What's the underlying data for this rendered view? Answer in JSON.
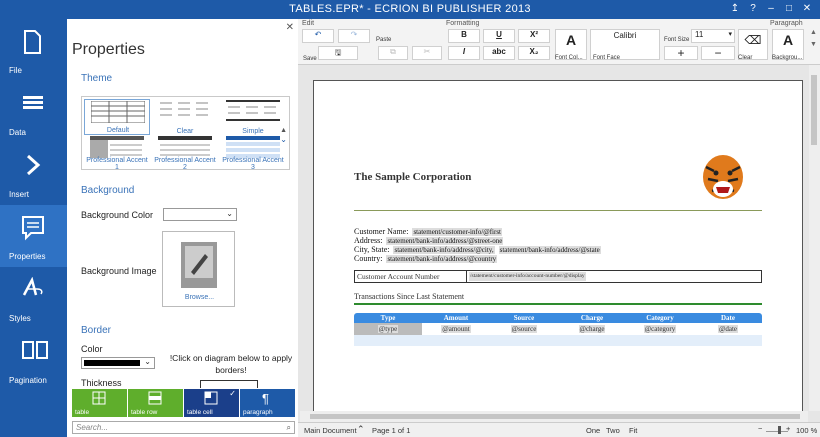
{
  "window": {
    "title": "TABLES.EPR* - ECRION BI PUBLISHER 2013"
  },
  "nav": [
    {
      "label": "File"
    },
    {
      "label": "Data"
    },
    {
      "label": "Insert"
    },
    {
      "label": "Properties"
    },
    {
      "label": "Styles"
    },
    {
      "label": "Pagination"
    }
  ],
  "properties": {
    "title": "Properties",
    "theme_label": "Theme",
    "themes": [
      "Default",
      "Clear",
      "Simple",
      "Professional Accent 1",
      "Professional Accent 2",
      "Professional Accent 3"
    ],
    "background_label": "Background",
    "bg_color_label": "Background Color",
    "bg_image_label": "Background Image",
    "browse_label": "Browse...",
    "border_label": "Border",
    "color_label": "Color",
    "hint": "!Click on diagram below to apply borders!",
    "thickness_label": "Thickness",
    "tiles": [
      "table",
      "table row",
      "table cell",
      "paragraph"
    ],
    "search_placeholder": "Search..."
  },
  "ribbon": {
    "groups": {
      "edit": "Edit",
      "formatting": "Formatting",
      "paragraph": "Paragraph"
    },
    "paste": "Paste",
    "save": "Save",
    "bold": "B",
    "underline": "U",
    "superscript": "X²",
    "italic": "I",
    "strike": "abc",
    "subscript": "X₂",
    "font_color_letter": "A",
    "font_color_label": "Font Col...",
    "font_face": "Calibri",
    "font_face_label": "Font Face",
    "font_size_label": "Font Size",
    "font_size": "11",
    "plus": "+",
    "minus": "−",
    "clear_label": "Clear",
    "background_label": "Backgrou..."
  },
  "document": {
    "company": "The Sample Corporation",
    "customer_name_label": "Customer Name:",
    "customer_name_field": "statement/customer-info/@first",
    "address_label": "Address:",
    "address_field": "statement/bank-info/address/@street-one",
    "city_label": "City, State:",
    "city_field": "statement/bank-info/address/@city,",
    "state_field": "statement/bank-info/address/@state",
    "country_label": "Country:",
    "country_field": "statement/bank-info/address/@country",
    "account_label": "Customer Account Number",
    "account_field": "/statement/customer-info/account-number/@display",
    "transactions_title": "Transactions Since Last Statement",
    "columns": [
      "Type",
      "Amount",
      "Source",
      "Charge",
      "Category",
      "Date"
    ],
    "row": [
      "@type",
      "@amount",
      "@source",
      "@charge",
      "@category",
      "@date"
    ]
  },
  "status": {
    "main_document": "Main Document",
    "page": "Page 1 of 1",
    "one": "One",
    "two": "Two",
    "fit": "Fit",
    "zoom": "100 %"
  },
  "colors": {
    "brand": "#1e5aa8",
    "accent": "#3a8be0",
    "tile_green": "#5fae2c",
    "tile_navy": "#1b3f8a"
  }
}
